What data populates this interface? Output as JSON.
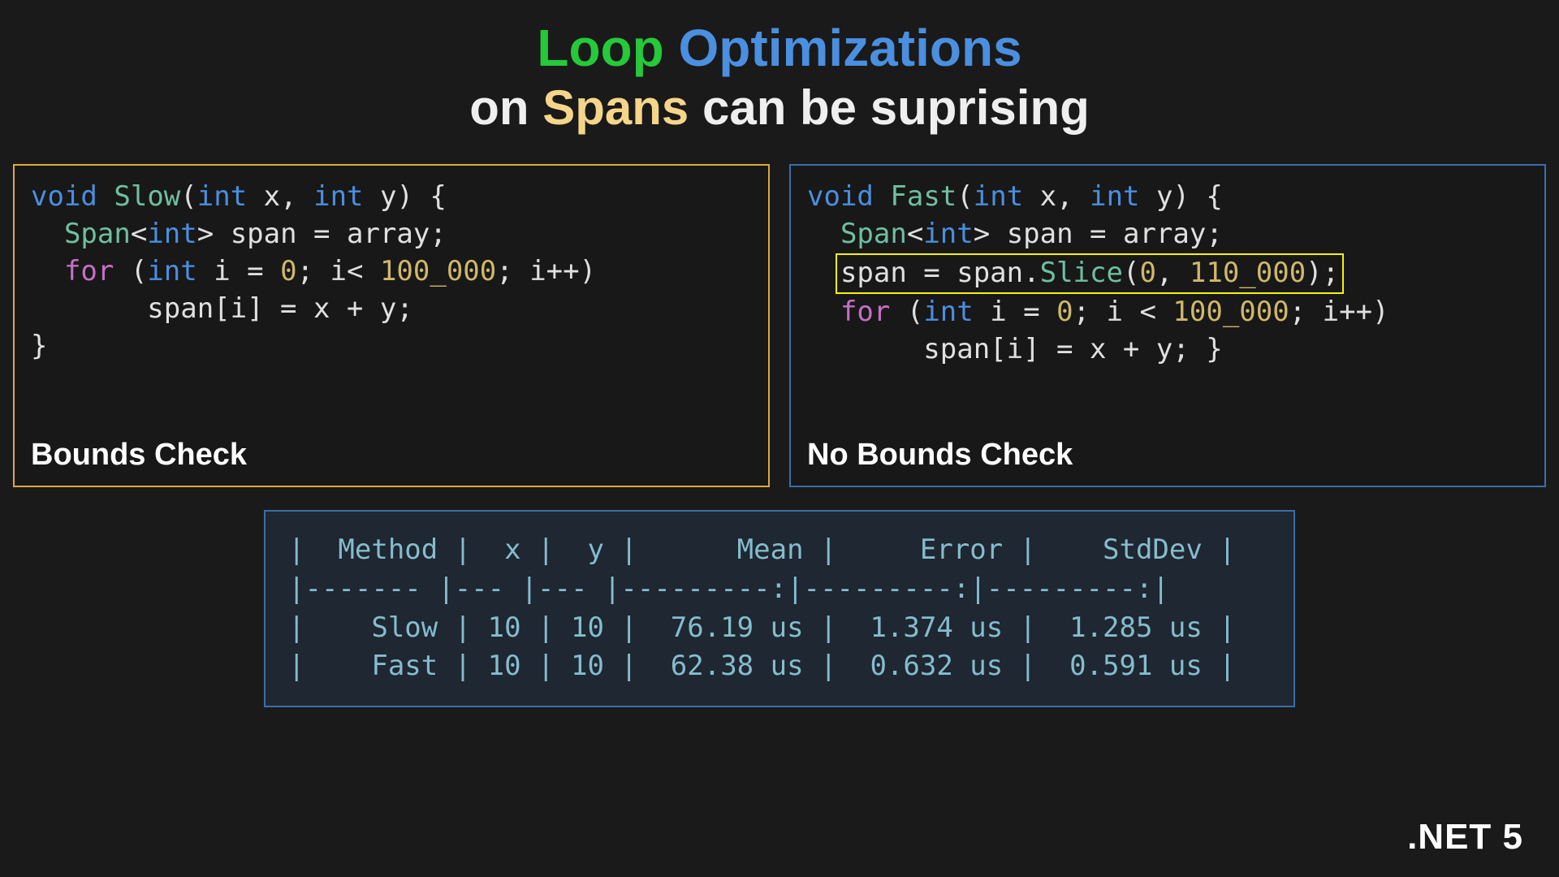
{
  "title": {
    "w1": "Loop",
    "w2": "Optimizations",
    "w3": "on",
    "w4": "Spans",
    "w5": "can be suprising"
  },
  "left": {
    "label": "Bounds Check",
    "code": {
      "l1_kw1": "void",
      "l1_fn": "Slow",
      "l1_kw2": "int",
      "l1_p1": "x",
      "l1_kw3": "int",
      "l1_p2": "y",
      "l2_ty": "Span",
      "l2_kw": "int",
      "l2_rest": " span = array;",
      "l3_for": "for",
      "l3_kw": "int",
      "l3_txt1": " i = ",
      "l3_n1": "0",
      "l3_txt2": "; i< ",
      "l3_n2": "100_000",
      "l3_txt3": "; i++)",
      "l4": "       span[i] = x + y;",
      "l5": "}"
    }
  },
  "right": {
    "label": "No Bounds Check",
    "code": {
      "l1_kw1": "void",
      "l1_fn": "Fast",
      "l1_kw2": "int",
      "l1_p1": "x",
      "l1_kw3": "int",
      "l1_p2": "y",
      "l2_ty": "Span",
      "l2_kw": "int",
      "l2_rest": " span = array;",
      "l3_txt1": "span = span.",
      "l3_fn": "Slice",
      "l3_txt2": "(",
      "l3_n1": "0",
      "l3_txt3": ", ",
      "l3_n2": "110_000",
      "l3_txt4": ");",
      "l4_for": "for",
      "l4_kw": "int",
      "l4_txt1": " i = ",
      "l4_n1": "0",
      "l4_txt2": "; i < ",
      "l4_n2": "100_000",
      "l4_txt3": "; i++)",
      "l5": "       span[i] = x + y; }"
    }
  },
  "bench": {
    "header": "|  Method |  x |  y |      Mean |     Error |    StdDev |",
    "sep": "|------- |--- |--- |---------:|---------:|---------:|",
    "row1": "|    Slow | 10 | 10 |  76.19 us |  1.374 us |  1.285 us |",
    "row2": "|    Fast | 10 | 10 |  62.38 us |  0.632 us |  0.591 us |"
  },
  "chart_data": {
    "type": "table",
    "columns": [
      "Method",
      "x",
      "y",
      "Mean",
      "Error",
      "StdDev"
    ],
    "rows": [
      {
        "Method": "Slow",
        "x": 10,
        "y": 10,
        "Mean": "76.19 us",
        "Error": "1.374 us",
        "StdDev": "1.285 us"
      },
      {
        "Method": "Fast",
        "x": 10,
        "y": 10,
        "Mean": "62.38 us",
        "Error": "0.632 us",
        "StdDev": "0.591 us"
      }
    ]
  },
  "footer": ".NET 5"
}
